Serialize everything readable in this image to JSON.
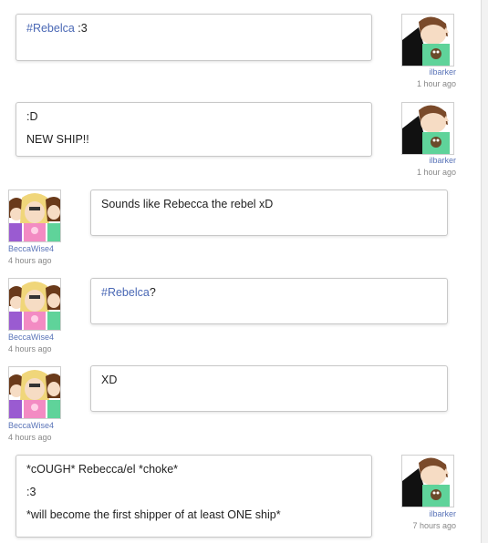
{
  "messages": [
    {
      "side": "right",
      "username": "ilbarker",
      "time": "1 hour ago",
      "lines": [
        [
          {
            "text": "#Rebelca",
            "hashtag": true
          },
          {
            "text": " :3"
          }
        ]
      ]
    },
    {
      "side": "right",
      "username": "ilbarker",
      "time": "1 hour ago",
      "lines": [
        [
          {
            "text": ":D"
          }
        ],
        [
          {
            "text": "NEW SHIP!!"
          }
        ]
      ]
    },
    {
      "side": "left",
      "username": "BeccaWise4",
      "time": "4 hours ago",
      "lines": [
        [
          {
            "text": "Sounds like Rebecca the rebel xD"
          }
        ]
      ]
    },
    {
      "side": "left",
      "username": "BeccaWise4",
      "time": "4 hours ago",
      "lines": [
        [
          {
            "text": "#Rebelca",
            "hashtag": true
          },
          {
            "text": "?"
          }
        ]
      ]
    },
    {
      "side": "left",
      "username": "BeccaWise4",
      "time": "4 hours ago",
      "lines": [
        [
          {
            "text": "XD"
          }
        ]
      ]
    },
    {
      "side": "right",
      "username": "ilbarker",
      "time": "7 hours ago",
      "lines": [
        [
          {
            "text": "*cOUGH* Rebecca/el *choke*"
          }
        ],
        [
          {
            "text": ":3"
          }
        ],
        [
          {
            "text": "*will become the first shipper of at least ONE ship*"
          }
        ]
      ]
    }
  ],
  "colors": {
    "hashtag": "#4a68b5",
    "username": "#5a74b8",
    "timestamp": "#888888",
    "bubble_border": "#c8c8c8"
  }
}
